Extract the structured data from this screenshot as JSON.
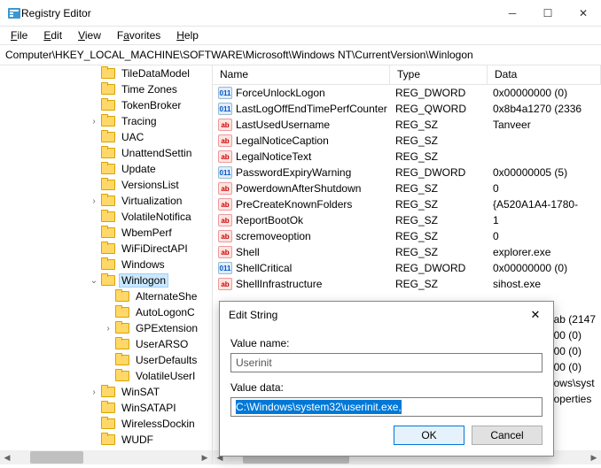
{
  "window": {
    "title": "Registry Editor"
  },
  "menu": {
    "file": "File",
    "edit": "Edit",
    "view": "View",
    "favorites": "Favorites",
    "help": "Help"
  },
  "address": "Computer\\HKEY_LOCAL_MACHINE\\SOFTWARE\\Microsoft\\Windows NT\\CurrentVersion\\Winlogon",
  "tree": [
    {
      "depth": 5,
      "exp": "",
      "label": "TileDataModel"
    },
    {
      "depth": 5,
      "exp": "",
      "label": "Time Zones"
    },
    {
      "depth": 5,
      "exp": "",
      "label": "TokenBroker"
    },
    {
      "depth": 5,
      "exp": ">",
      "label": "Tracing"
    },
    {
      "depth": 5,
      "exp": "",
      "label": "UAC"
    },
    {
      "depth": 5,
      "exp": "",
      "label": "UnattendSettin"
    },
    {
      "depth": 5,
      "exp": "",
      "label": "Update"
    },
    {
      "depth": 5,
      "exp": "",
      "label": "VersionsList"
    },
    {
      "depth": 5,
      "exp": ">",
      "label": "Virtualization"
    },
    {
      "depth": 5,
      "exp": "",
      "label": "VolatileNotifica"
    },
    {
      "depth": 5,
      "exp": "",
      "label": "WbemPerf"
    },
    {
      "depth": 5,
      "exp": "",
      "label": "WiFiDirectAPI"
    },
    {
      "depth": 5,
      "exp": "",
      "label": "Windows"
    },
    {
      "depth": 5,
      "exp": "v",
      "label": "Winlogon",
      "selected": true
    },
    {
      "depth": 6,
      "exp": "",
      "label": "AlternateShe"
    },
    {
      "depth": 6,
      "exp": "",
      "label": "AutoLogonC"
    },
    {
      "depth": 6,
      "exp": ">",
      "label": "GPExtension"
    },
    {
      "depth": 6,
      "exp": "",
      "label": "UserARSO"
    },
    {
      "depth": 6,
      "exp": "",
      "label": "UserDefaults"
    },
    {
      "depth": 6,
      "exp": "",
      "label": "VolatileUserI"
    },
    {
      "depth": 5,
      "exp": ">",
      "label": "WinSAT"
    },
    {
      "depth": 5,
      "exp": "",
      "label": "WinSATAPI"
    },
    {
      "depth": 5,
      "exp": "",
      "label": "WirelessDockin"
    },
    {
      "depth": 5,
      "exp": "",
      "label": "WUDF"
    }
  ],
  "columns": {
    "name": "Name",
    "type": "Type",
    "data": "Data"
  },
  "values": [
    {
      "icon": "dw",
      "name": "ForceUnlockLogon",
      "type": "REG_DWORD",
      "data": "0x00000000 (0)"
    },
    {
      "icon": "dw",
      "name": "LastLogOffEndTimePerfCounter",
      "type": "REG_QWORD",
      "data": "0x8b4a1270 (2336"
    },
    {
      "icon": "sz",
      "name": "LastUsedUsername",
      "type": "REG_SZ",
      "data": "Tanveer"
    },
    {
      "icon": "sz",
      "name": "LegalNoticeCaption",
      "type": "REG_SZ",
      "data": ""
    },
    {
      "icon": "sz",
      "name": "LegalNoticeText",
      "type": "REG_SZ",
      "data": ""
    },
    {
      "icon": "dw",
      "name": "PasswordExpiryWarning",
      "type": "REG_DWORD",
      "data": "0x00000005 (5)"
    },
    {
      "icon": "sz",
      "name": "PowerdownAfterShutdown",
      "type": "REG_SZ",
      "data": "0"
    },
    {
      "icon": "sz",
      "name": "PreCreateKnownFolders",
      "type": "REG_SZ",
      "data": "{A520A1A4-1780-"
    },
    {
      "icon": "sz",
      "name": "ReportBootOk",
      "type": "REG_SZ",
      "data": "1"
    },
    {
      "icon": "sz",
      "name": "scremoveoption",
      "type": "REG_SZ",
      "data": "0"
    },
    {
      "icon": "sz",
      "name": "Shell",
      "type": "REG_SZ",
      "data": "explorer.exe"
    },
    {
      "icon": "dw",
      "name": "ShellCritical",
      "type": "REG_DWORD",
      "data": "0x00000000 (0)"
    },
    {
      "icon": "sz",
      "name": "ShellInfrastructure",
      "type": "REG_SZ",
      "data": "sihost.exe"
    }
  ],
  "obscured_data": [
    "ab (2147",
    "00 (0)",
    "00 (0)",
    "00 (0)",
    "",
    "ows\\syst",
    "operties"
  ],
  "dialog": {
    "title": "Edit String",
    "name_label": "Value name:",
    "name_value": "Userinit",
    "data_label": "Value data:",
    "data_value": "C:\\Windows\\system32\\userinit.exe,",
    "ok": "OK",
    "cancel": "Cancel"
  }
}
